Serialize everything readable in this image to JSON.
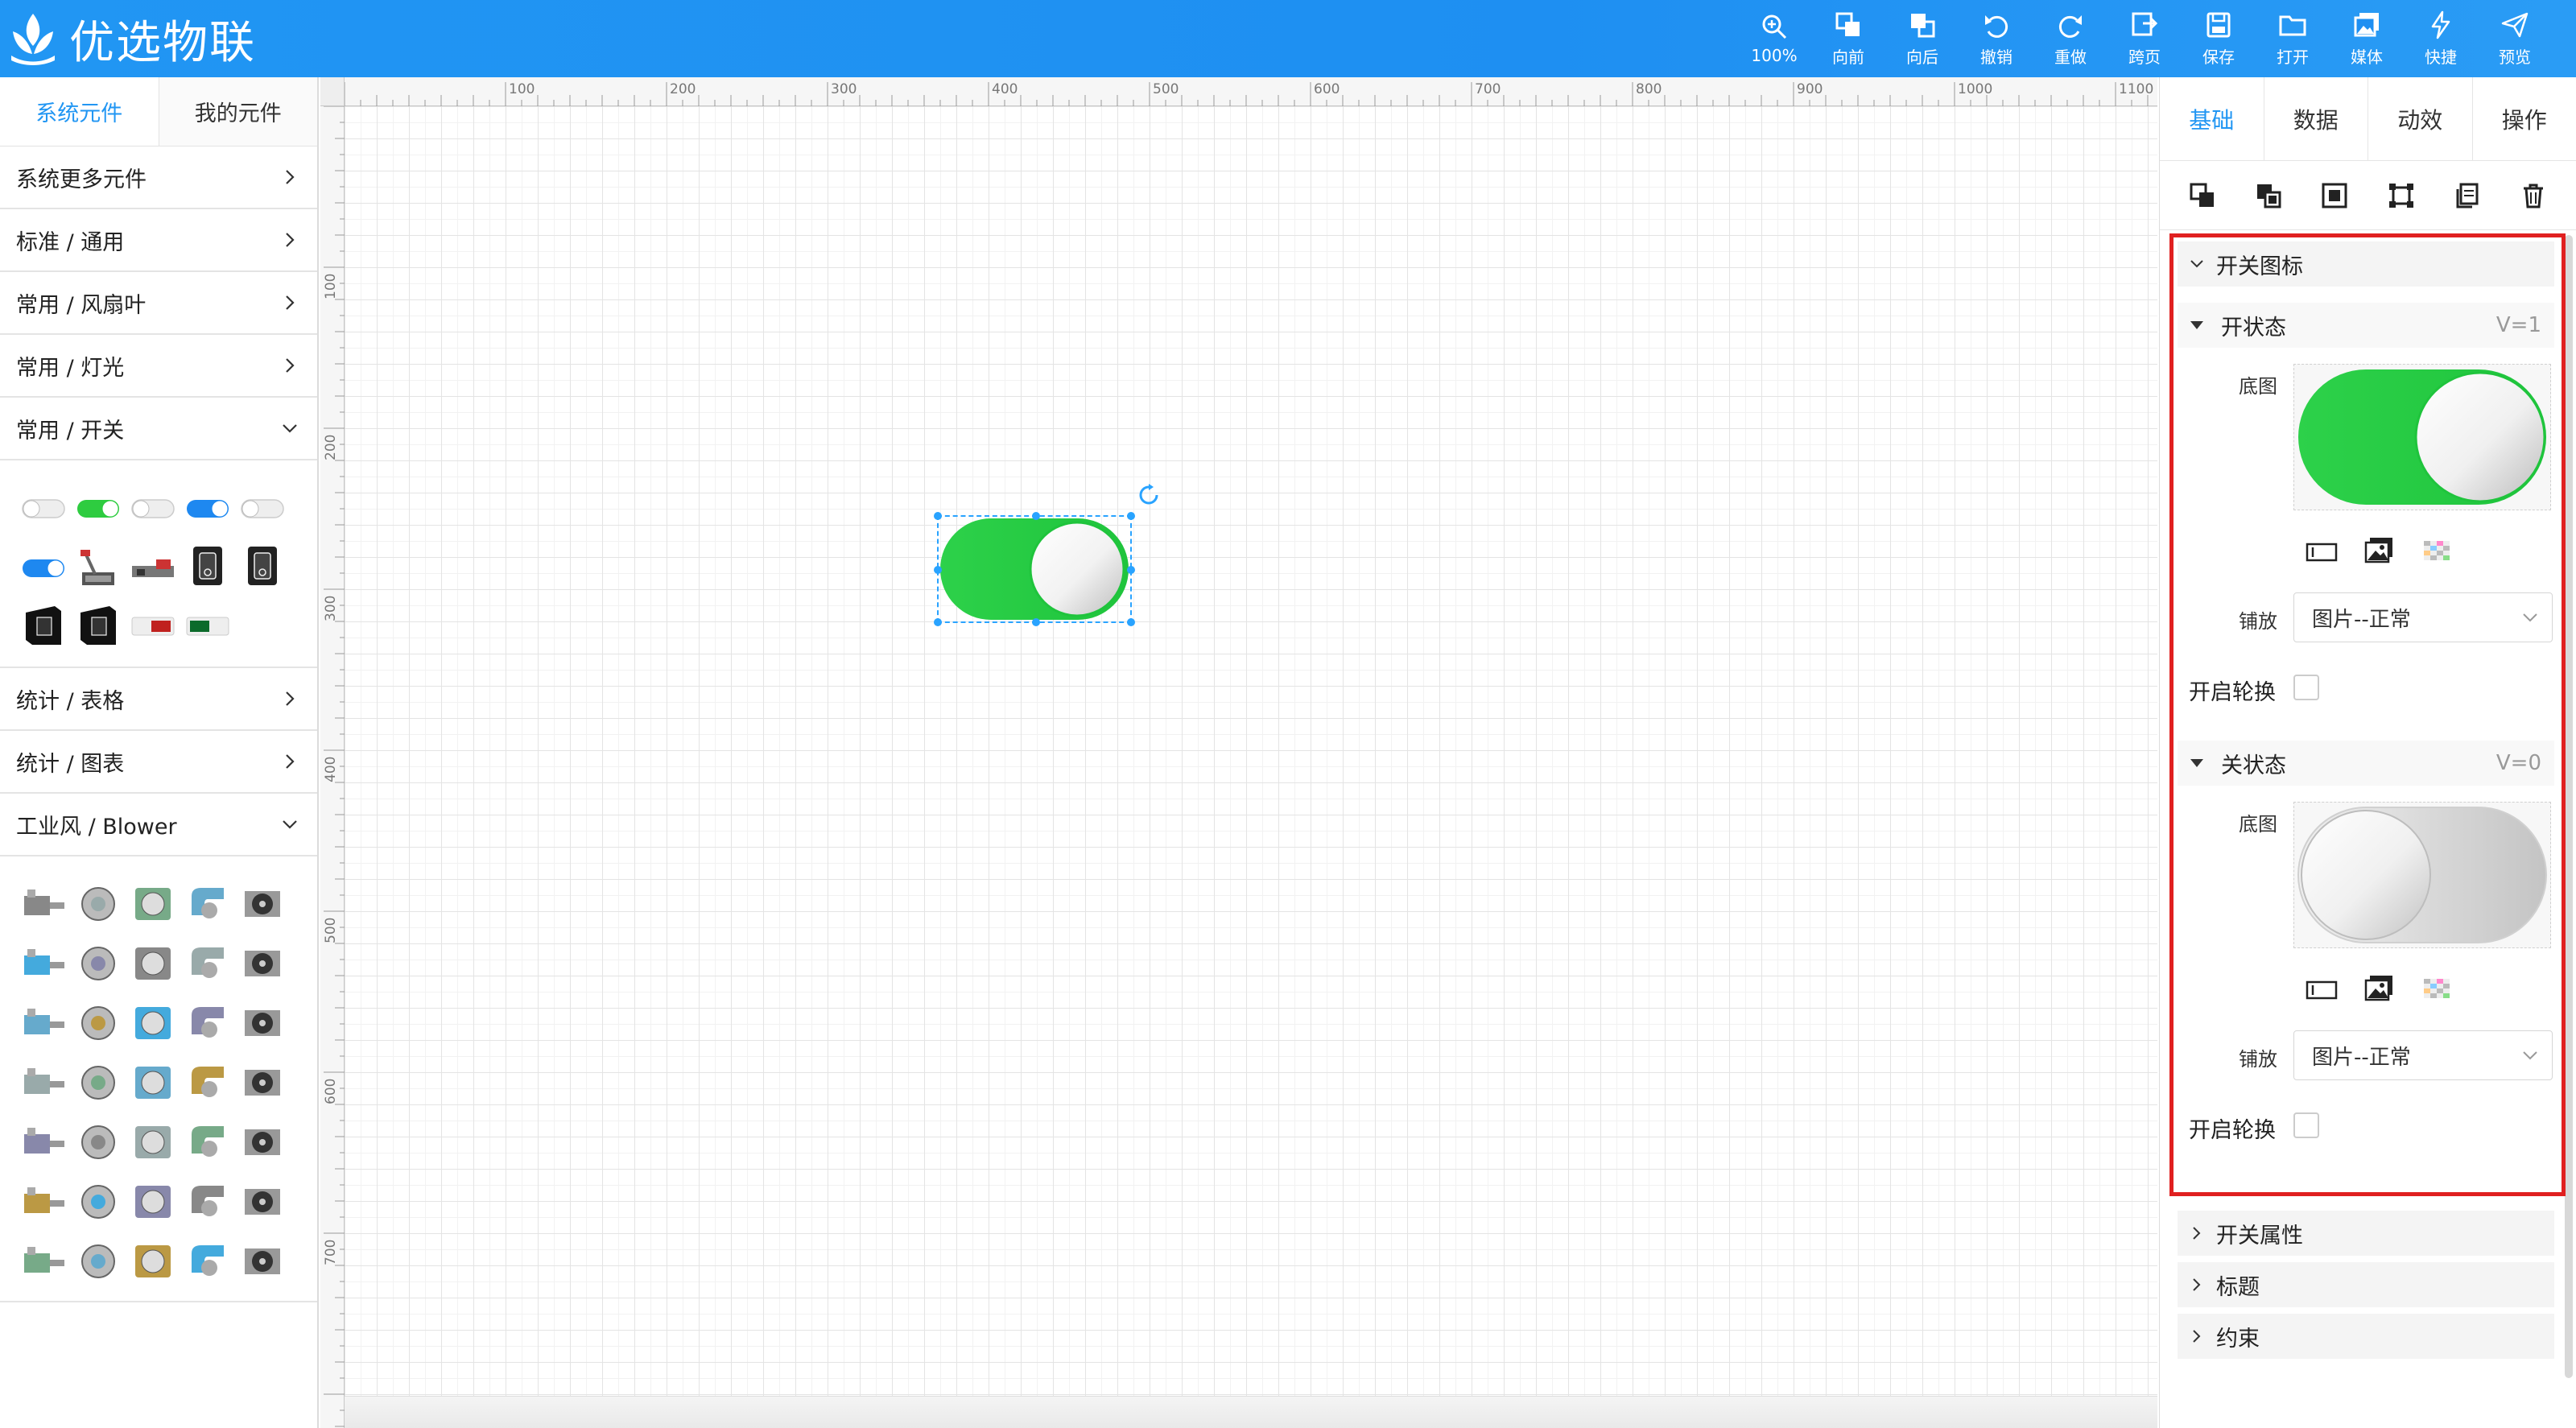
{
  "app": {
    "title": "优选物联"
  },
  "toolbar": [
    {
      "label": "100%",
      "icon": "zoom-icon"
    },
    {
      "label": "向前",
      "icon": "bring-forward-icon"
    },
    {
      "label": "向后",
      "icon": "send-backward-icon"
    },
    {
      "label": "撤销",
      "icon": "undo-icon"
    },
    {
      "label": "重做",
      "icon": "redo-icon"
    },
    {
      "label": "跨页",
      "icon": "cross-page-icon"
    },
    {
      "label": "保存",
      "icon": "save-icon"
    },
    {
      "label": "打开",
      "icon": "open-folder-icon"
    },
    {
      "label": "媒体",
      "icon": "media-icon"
    },
    {
      "label": "快捷",
      "icon": "lightning-icon"
    },
    {
      "label": "预览",
      "icon": "send-icon"
    }
  ],
  "left_panel": {
    "tabs": [
      "系统元件",
      "我的元件"
    ],
    "active_tab": 0,
    "categories": [
      {
        "label": "系统更多元件",
        "expanded": false
      },
      {
        "label": "标准 / 通用",
        "expanded": false
      },
      {
        "label": "常用 / 风扇叶",
        "expanded": false
      },
      {
        "label": "常用 / 灯光",
        "expanded": false
      },
      {
        "label": "常用 / 开关",
        "expanded": true
      },
      {
        "label": "统计 / 表格",
        "expanded": false
      },
      {
        "label": "统计 / 图表",
        "expanded": false
      },
      {
        "label": "工业风 / Blower",
        "expanded": true
      }
    ],
    "switch_items": [
      "toggle-off-icon",
      "toggle-on-green-icon",
      "toggle-off-icon",
      "toggle-on-blue-icon",
      "toggle-off-icon",
      "toggle-on-blue-icon",
      "lever-switch-icon",
      "knife-switch-icon",
      "rocker-switch-icon",
      "rocker-switch-icon",
      "panel-switch-icon",
      "panel-switch-icon",
      "red-indicator-icon",
      "green-indicator-icon"
    ],
    "blower_item_count": 35
  },
  "rulers": {
    "top": [
      "100",
      "200",
      "300",
      "400",
      "500",
      "600",
      "700",
      "800",
      "900",
      "1000",
      "1100"
    ],
    "left": [
      "100",
      "200",
      "300",
      "400",
      "500",
      "600",
      "700"
    ]
  },
  "right_panel": {
    "tabs": [
      "基础",
      "数据",
      "动效",
      "操作"
    ],
    "active_tab": 0,
    "tools": [
      "bring-to-front-icon",
      "send-to-back-icon",
      "fit-icon",
      "resize-icon",
      "copy-icon",
      "delete-icon"
    ],
    "section_title": "开关图标",
    "on_state": {
      "title": "开状态",
      "value": "V=1",
      "image_label": "底图",
      "tile_label": "铺放",
      "tile_value": "图片--正常",
      "rotate_label": "开启轮换"
    },
    "off_state": {
      "title": "关状态",
      "value": "V=0",
      "image_label": "底图",
      "tile_label": "铺放",
      "tile_value": "图片--正常",
      "rotate_label": "开启轮换"
    },
    "collapsed_sections": [
      "开关属性",
      "标题",
      "约束"
    ]
  },
  "colors": {
    "accent": "#2196f3",
    "switch_on": "#2ecc40",
    "highlight": "#e02020"
  }
}
